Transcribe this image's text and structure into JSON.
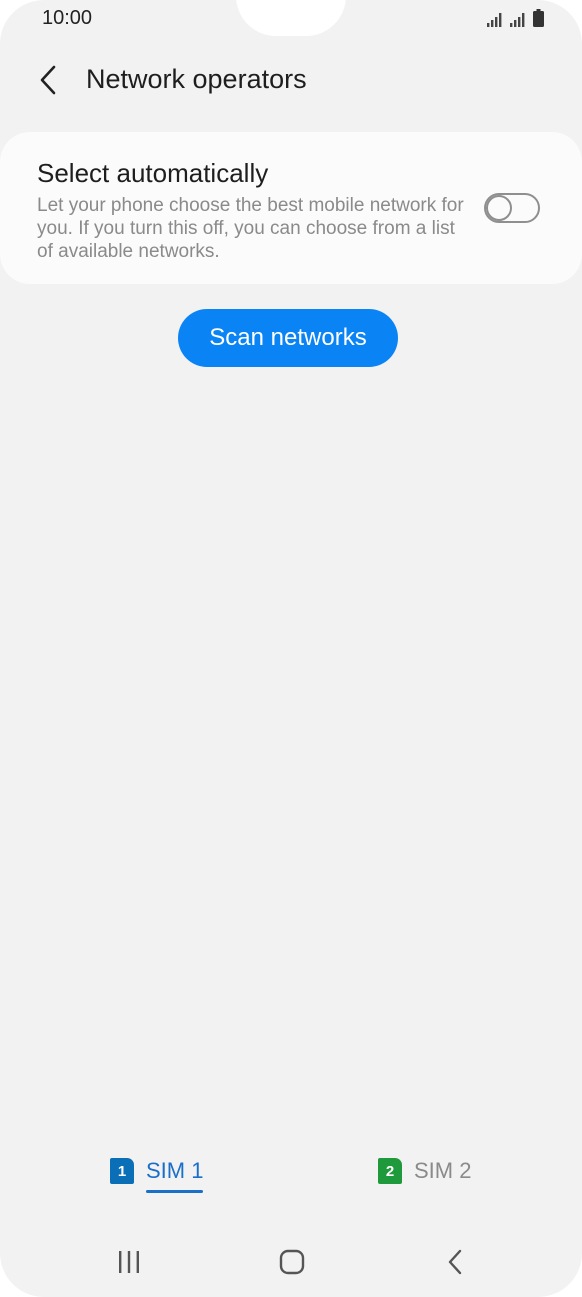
{
  "status_bar": {
    "time": "10:00",
    "icons": [
      "signal-sim1-icon",
      "signal-sim2-icon",
      "battery-icon"
    ]
  },
  "header": {
    "back_icon": "chevron-left-icon",
    "title": "Network operators"
  },
  "auto_select": {
    "title": "Select automatically",
    "description": "Let your phone choose the best mobile network for you. If you turn this off, you can choose from a list of available networks.",
    "enabled": false
  },
  "scan_button": {
    "label": "Scan networks"
  },
  "sim_tabs": [
    {
      "badge": "1",
      "label": "SIM 1",
      "active": true,
      "color": "#0b6fb8"
    },
    {
      "badge": "2",
      "label": "SIM 2",
      "active": false,
      "color": "#1e9a3c"
    }
  ],
  "nav_bar": {
    "icons": [
      "recents-icon",
      "home-icon",
      "back-icon"
    ]
  },
  "colors": {
    "accent": "#0a84f5",
    "active_tab": "#1a6fc8",
    "background": "#f2f2f2"
  }
}
